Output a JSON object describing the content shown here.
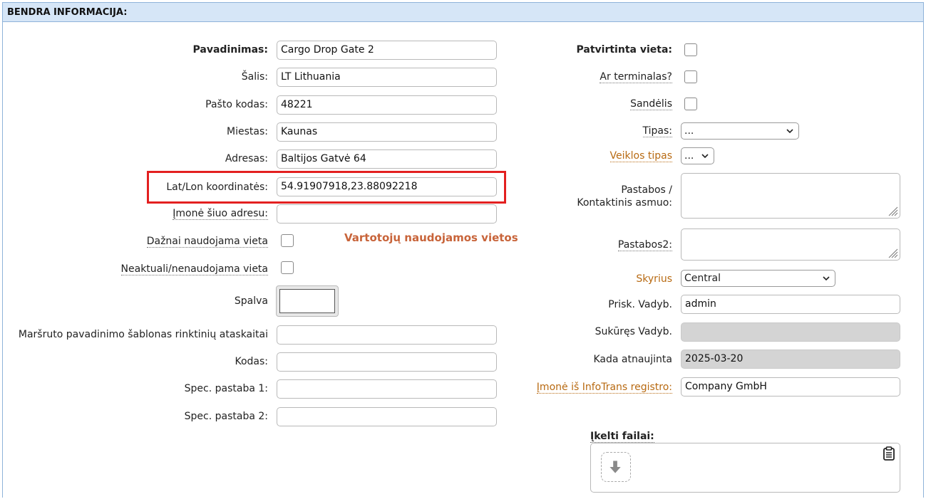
{
  "header": {
    "title": "BENDRA INFORMACIJA:"
  },
  "left": {
    "name": {
      "label": "Pavadinimas:",
      "value": "Cargo Drop Gate 2"
    },
    "country": {
      "label": "Šalis:",
      "value": "LT Lithuania"
    },
    "postal": {
      "label": "Pašto kodas:",
      "value": "48221"
    },
    "city": {
      "label": "Miestas:",
      "value": "Kaunas"
    },
    "address": {
      "label": "Adresas:",
      "value": "Baltijos Gatvė 64"
    },
    "coords": {
      "label": "Lat/Lon koordinatės:",
      "value": "54.91907918,23.88092218"
    },
    "company_here": {
      "label": "Įmonė šiuo adresu:",
      "value": ""
    },
    "frequent": {
      "label": "Dažnai naudojama vieta"
    },
    "inactive": {
      "label": "Neaktuali/nenaudojama vieta"
    },
    "color": {
      "label": "Spalva"
    },
    "route_template": {
      "label": "Maršruto pavadinimo šablonas rinktinių ataskaitai",
      "value": ""
    },
    "code": {
      "label": "Kodas:",
      "value": ""
    },
    "note1": {
      "label": "Spec. pastaba 1:",
      "value": ""
    },
    "note2": {
      "label": "Spec. pastaba 2:",
      "value": ""
    }
  },
  "user_locations_heading": "Vartotojų naudojamos vietos",
  "right": {
    "confirmed": {
      "label": "Patvirtinta vieta:"
    },
    "terminal": {
      "label": "Ar terminalas?"
    },
    "warehouse": {
      "label": "Sandėlis"
    },
    "type": {
      "label": "Tipas:",
      "value": "..."
    },
    "activity_type": {
      "label": "Veiklos tipas",
      "value": "..."
    },
    "notes_contact": {
      "label_line1": "Pastabos /",
      "label_line2": "Kontaktinis asmuo:"
    },
    "notes2": {
      "label": "Pastabos2:"
    },
    "department": {
      "label": "Skyrius",
      "value": "Central"
    },
    "assigned_manager": {
      "label": "Prisk. Vadyb.",
      "value": "admin"
    },
    "created_manager": {
      "label": "Sukūręs Vadyb.",
      "value": ""
    },
    "updated_at": {
      "label": "Kada atnaujinta",
      "value": "2025-03-20"
    },
    "infotrans_company": {
      "label": "Įmonė iš InfoTrans registro:",
      "value": "Company GmbH"
    },
    "uploaded_files": {
      "label": "Įkelti failai:"
    }
  },
  "colors": {
    "header_bg": "#d6e6f7",
    "highlight": "#e32020",
    "link": "#b86a12",
    "heading_orange": "#c8643a"
  },
  "icons": {
    "dropdown": "chevron-down-icon",
    "upload": "arrow-down-icon",
    "clipboard": "clipboard-icon"
  }
}
